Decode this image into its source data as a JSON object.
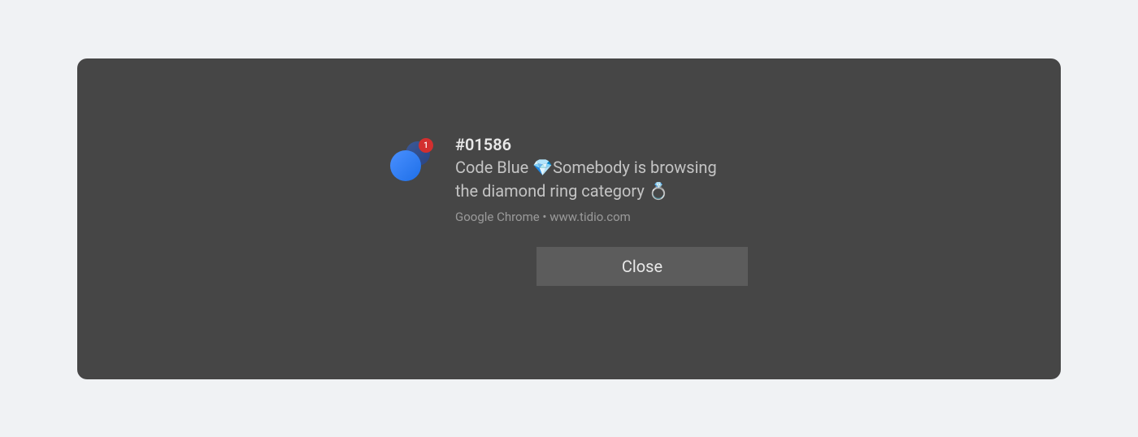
{
  "notification": {
    "badge_count": "1",
    "title": "#01586",
    "message_line1": "Code Blue 💎Somebody is browsing",
    "message_line2": "the diamond ring category 💍",
    "source": "Google Chrome • www.tidio.com",
    "close_label": "Close"
  }
}
